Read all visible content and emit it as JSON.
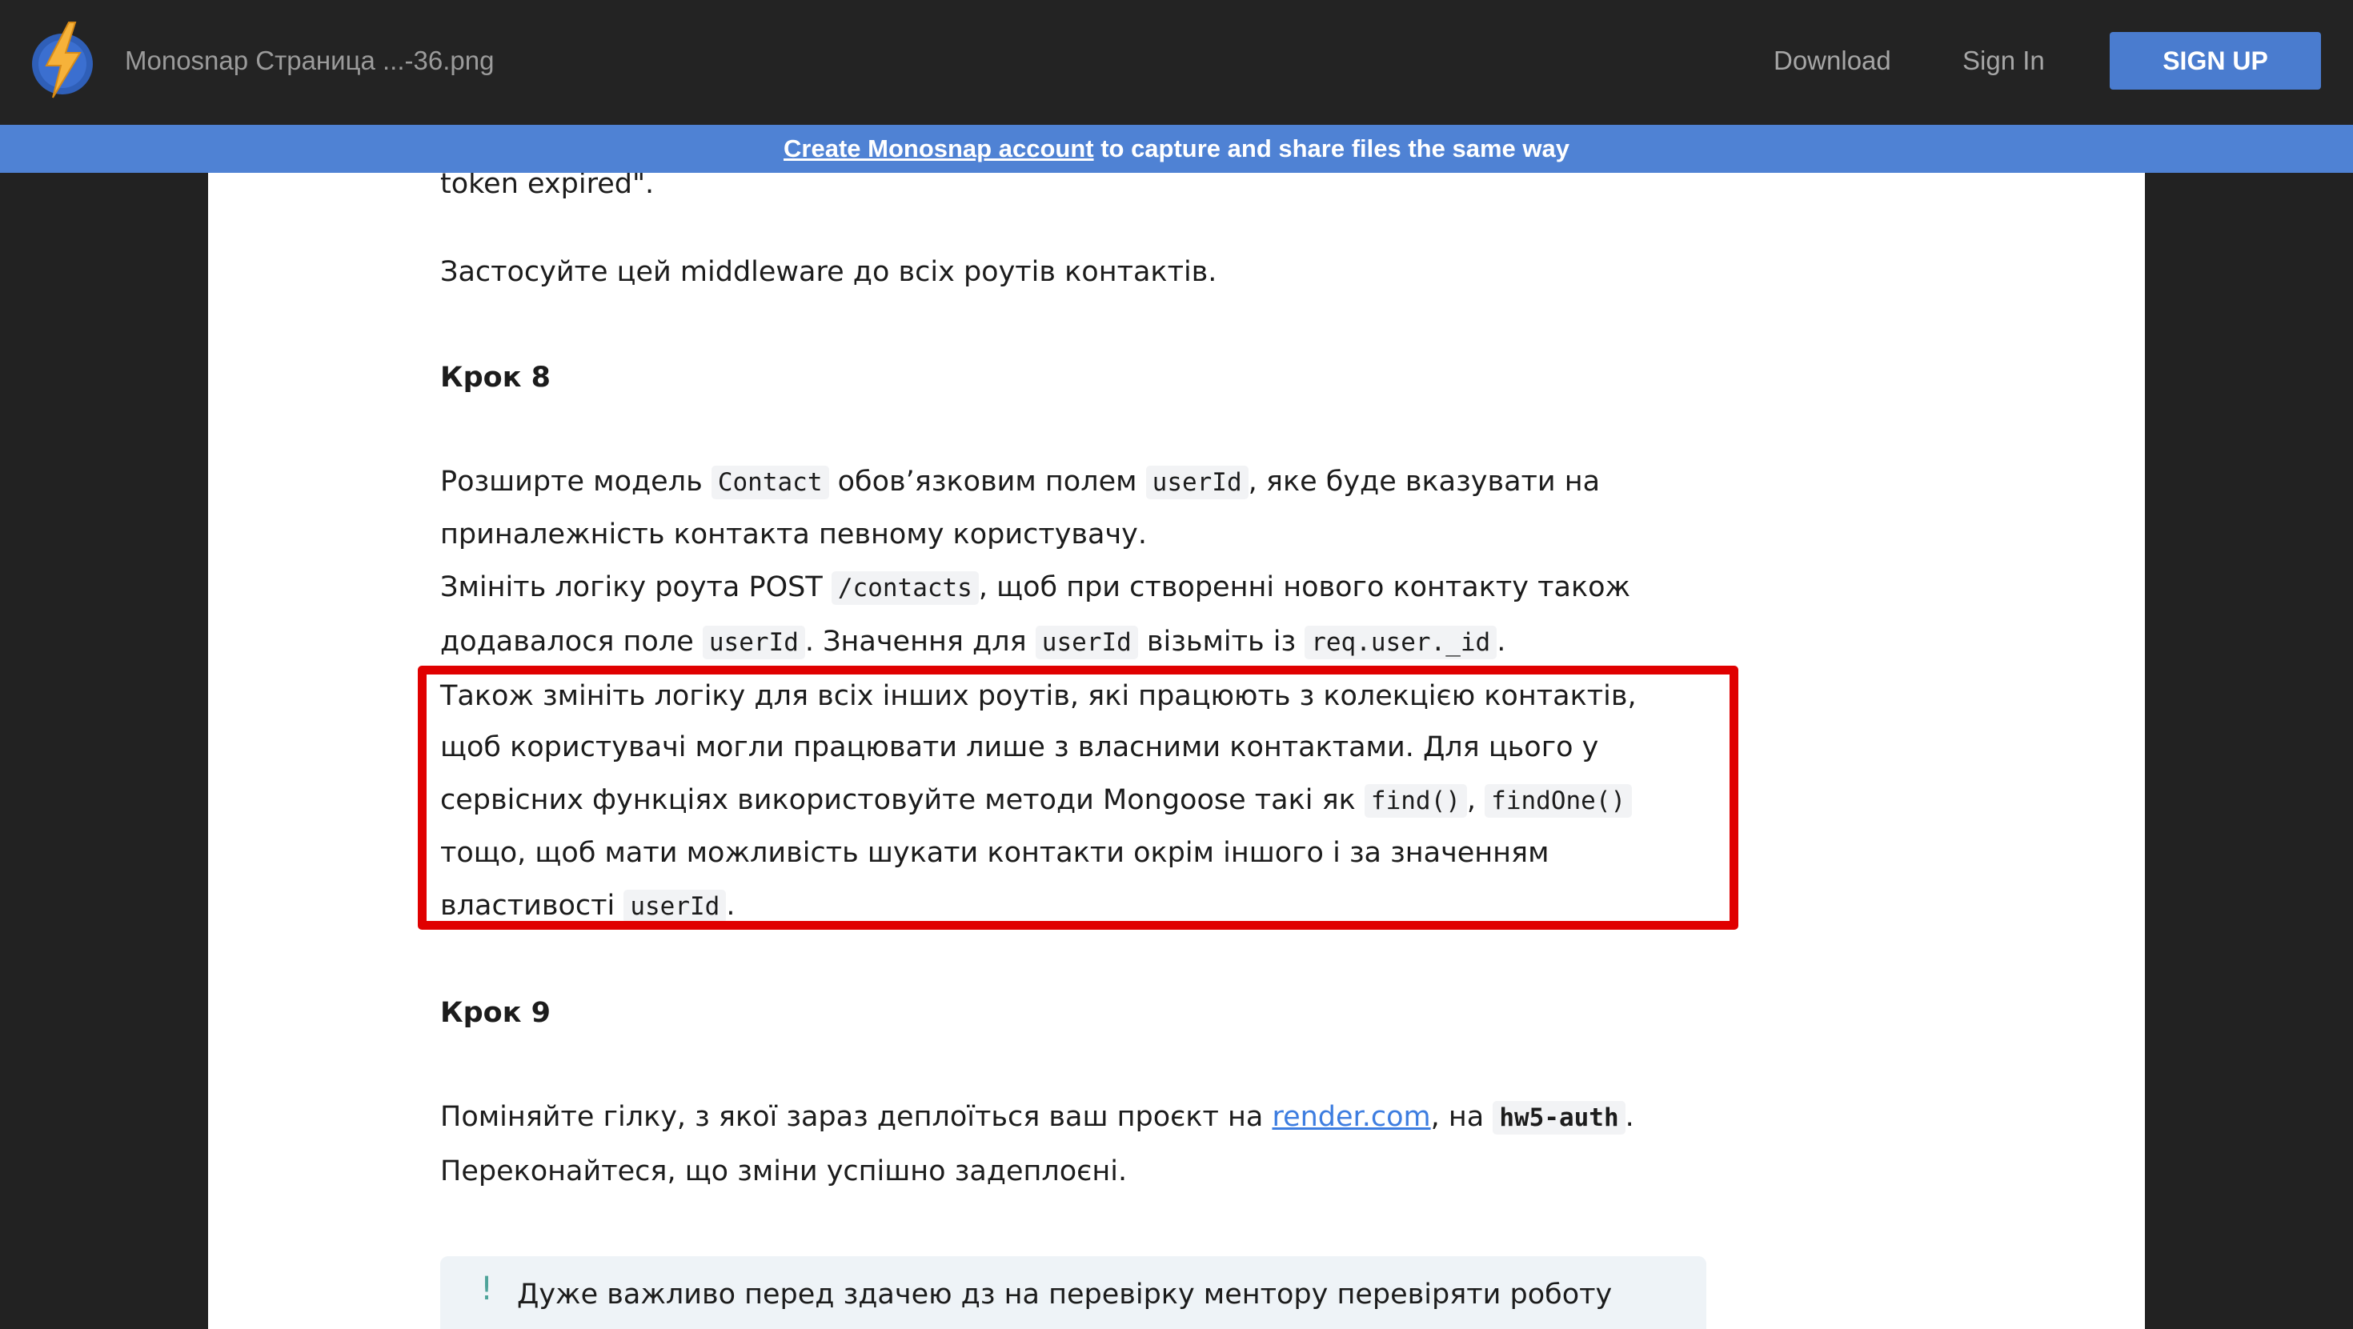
{
  "header": {
    "file_title": "Monosnap Страница ...-36.png",
    "nav_download": "Download",
    "nav_signin": "Sign In",
    "signup_label": "SIGN UP"
  },
  "banner": {
    "link_text": "Create Monosnap account",
    "rest_text": " to capture and share files the same way"
  },
  "doc": {
    "cut_line": "token expired\".",
    "step7_apply": "Застосуйте цей middleware до всіх роутів контактів.",
    "step8_heading": "Крок 8",
    "p1_a": "Розширте модель ",
    "p1_code1": "Contact",
    "p1_b": " обов’язковим полем ",
    "p1_code2": "userId",
    "p1_c": ", яке буде вказувати на",
    "p2": "приналежність контакта певному користувачу.",
    "p3_a": "Змініть логіку роута POST ",
    "p3_code": "/contacts",
    "p3_b": ", щоб при створенні нового контакту також",
    "p4_a": "додавалося поле ",
    "p4_code1": "userId",
    "p4_b": ". Значення для ",
    "p4_code2": "userId",
    "p4_c": " візьміть із ",
    "p4_code3": "req.user._id",
    "p4_d": ".",
    "h1": "Також змініть логіку для всіх інших роутів, які працюють з колекцією контактів,",
    "h2": "щоб користувачі могли працювати лише з власними контактами. Для цього у",
    "h3_a": "сервісних функціях використовуйте методи Mongoose такі як ",
    "h3_code1": "find()",
    "h3_b": ", ",
    "h3_code2": "findOne()",
    "h4": "тощо, щоб мати можливість шукати контакти окрім іншого і за значенням",
    "h5_a": "властивості ",
    "h5_code": "userId",
    "h5_b": ".",
    "step9_heading": "Крок 9",
    "s9_a": "Поміняйте гілку, з якої зараз деплоїться ваш проєкт на ",
    "s9_link": "render.com",
    "s9_b": ", на ",
    "s9_code": "hw5-auth",
    "s9_c": ".",
    "s9_line2": "Переконайтеся, що зміни успішно задеплоєні.",
    "note_mark": "!",
    "note_text": "Дуже важливо перед здачею дз на перевірку ментору перевіряти роботу"
  },
  "colors": {
    "accent": "#4a7ccf",
    "banner": "#4f82d4",
    "highlight": "#e00000",
    "link": "#3d7de0"
  },
  "icons": {
    "logo": "lightning-bolt-logo-icon"
  }
}
